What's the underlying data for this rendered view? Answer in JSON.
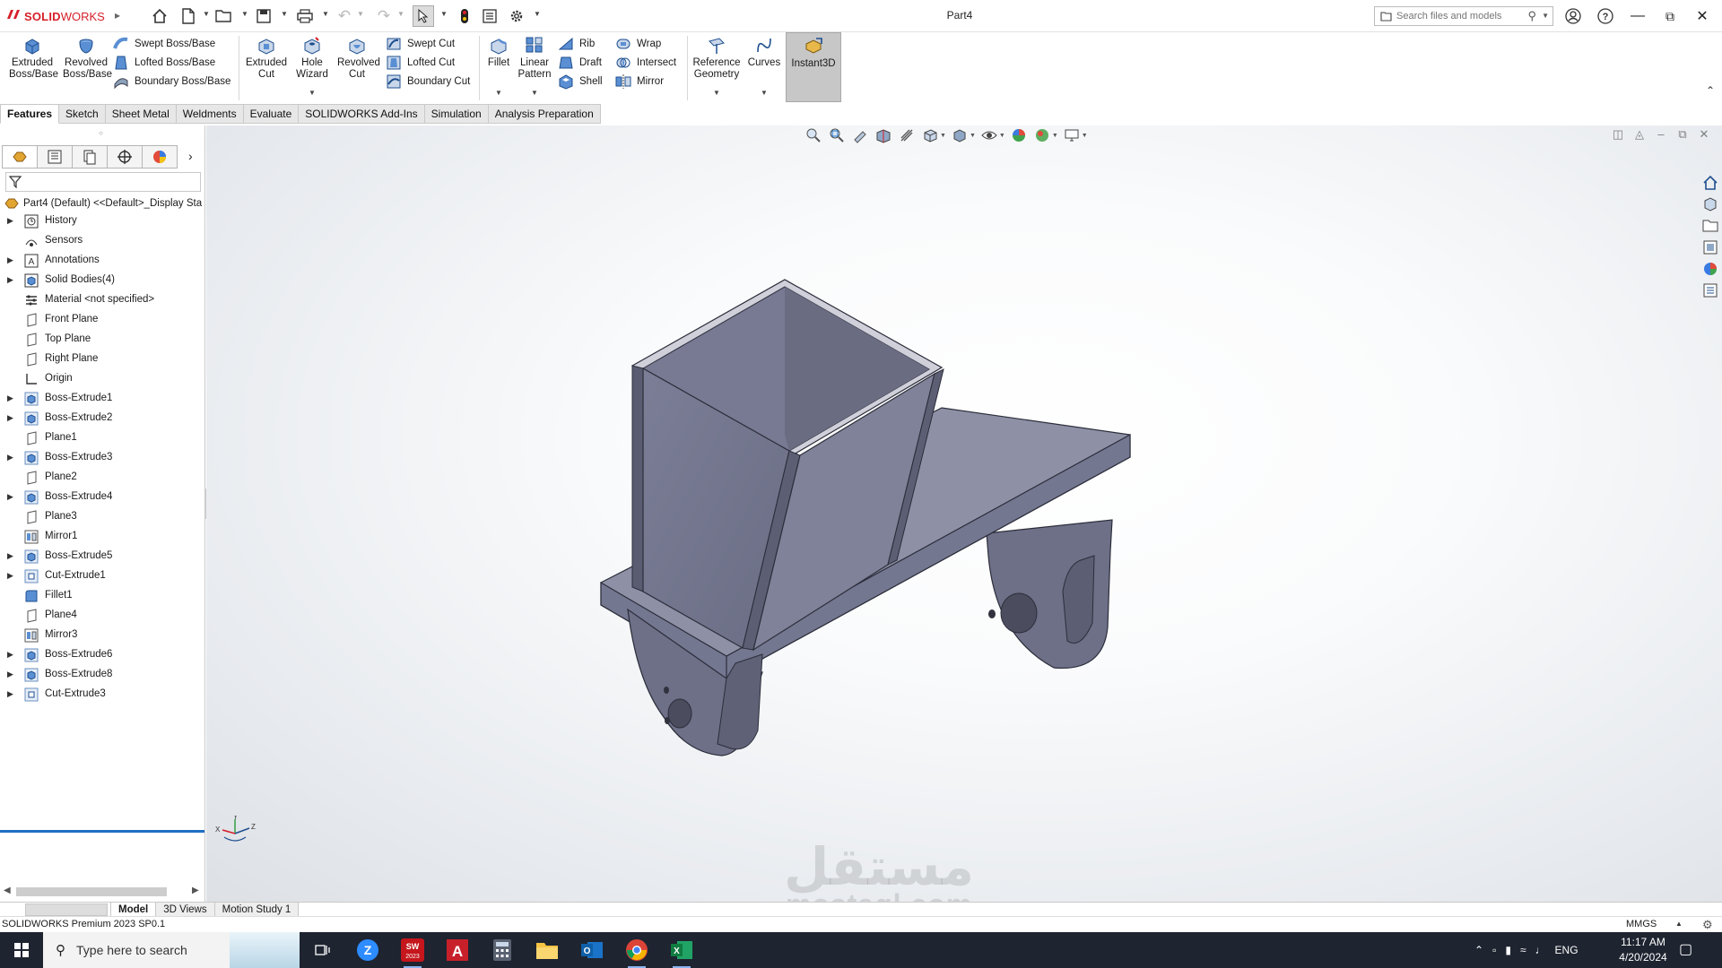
{
  "app": {
    "logo_prefix": "3S",
    "logo_text": "SOLID",
    "logo_text_light": "WORKS",
    "document_title": "Part4",
    "search_placeholder": "Search files and models"
  },
  "ribbon": {
    "extruded_boss": "Extruded Boss/Base",
    "revolved_boss": "Revolved Boss/Base",
    "swept_boss": "Swept Boss/Base",
    "lofted_boss": "Lofted Boss/Base",
    "boundary_boss": "Boundary Boss/Base",
    "extruded_cut": "Extruded Cut",
    "hole_wizard": "Hole Wizard",
    "revolved_cut": "Revolved Cut",
    "swept_cut": "Swept Cut",
    "lofted_cut": "Lofted Cut",
    "boundary_cut": "Boundary Cut",
    "fillet": "Fillet",
    "linear_pattern": "Linear Pattern",
    "rib": "Rib",
    "draft": "Draft",
    "shell": "Shell",
    "wrap": "Wrap",
    "intersect": "Intersect",
    "mirror": "Mirror",
    "reference_geometry": "Reference Geometry",
    "curves": "Curves",
    "instant3d": "Instant3D"
  },
  "cm_tabs": [
    "Features",
    "Sketch",
    "Sheet Metal",
    "Weldments",
    "Evaluate",
    "SOLIDWORKS Add-Ins",
    "Simulation",
    "Analysis Preparation"
  ],
  "feature_tree": {
    "root": "Part4  (Default) <<Default>_Display Sta",
    "items": [
      {
        "label": "History",
        "icon": "history-icon",
        "expandable": true
      },
      {
        "label": "Sensors",
        "icon": "sensors-icon",
        "expandable": false
      },
      {
        "label": "Annotations",
        "icon": "annotations-icon",
        "expandable": true
      },
      {
        "label": "Solid Bodies(4)",
        "icon": "solid-bodies-icon",
        "expandable": true
      },
      {
        "label": "Material <not specified>",
        "icon": "material-icon",
        "expandable": false
      },
      {
        "label": "Front Plane",
        "icon": "plane-icon",
        "expandable": false
      },
      {
        "label": "Top Plane",
        "icon": "plane-icon",
        "expandable": false
      },
      {
        "label": "Right Plane",
        "icon": "plane-icon",
        "expandable": false
      },
      {
        "label": "Origin",
        "icon": "origin-icon",
        "expandable": false
      },
      {
        "label": "Boss-Extrude1",
        "icon": "boss-extrude-icon",
        "expandable": true
      },
      {
        "label": "Boss-Extrude2",
        "icon": "boss-extrude-icon",
        "expandable": true
      },
      {
        "label": "Plane1",
        "icon": "plane-icon",
        "expandable": false
      },
      {
        "label": "Boss-Extrude3",
        "icon": "boss-extrude-icon",
        "expandable": true
      },
      {
        "label": "Plane2",
        "icon": "plane-icon",
        "expandable": false
      },
      {
        "label": "Boss-Extrude4",
        "icon": "boss-extrude-icon",
        "expandable": true
      },
      {
        "label": "Plane3",
        "icon": "plane-icon",
        "expandable": false
      },
      {
        "label": "Mirror1",
        "icon": "mirror-icon",
        "expandable": false
      },
      {
        "label": "Boss-Extrude5",
        "icon": "boss-extrude-icon",
        "expandable": true
      },
      {
        "label": "Cut-Extrude1",
        "icon": "cut-extrude-icon",
        "expandable": true
      },
      {
        "label": "Fillet1",
        "icon": "fillet-icon",
        "expandable": false
      },
      {
        "label": "Plane4",
        "icon": "plane-icon",
        "expandable": false
      },
      {
        "label": "Mirror3",
        "icon": "mirror-icon",
        "expandable": false
      },
      {
        "label": "Boss-Extrude6",
        "icon": "boss-extrude-icon",
        "expandable": true
      },
      {
        "label": "Boss-Extrude8",
        "icon": "boss-extrude-icon",
        "expandable": true
      },
      {
        "label": "Cut-Extrude3",
        "icon": "cut-extrude-icon",
        "expandable": true
      }
    ]
  },
  "triad": {
    "x": "X",
    "y": "Y",
    "z": "Z"
  },
  "watermark": {
    "arabic": "مستقل",
    "latin": "mostaql.com"
  },
  "bottom_tabs": [
    "Model",
    "3D Views",
    "Motion Study 1"
  ],
  "status": {
    "text": "SOLIDWORKS Premium 2023 SP0.1",
    "units": "MMGS"
  },
  "taskbar": {
    "search_placeholder": "Type here to search",
    "language": "ENG",
    "time": "11:17 AM",
    "date": "4/20/2024",
    "sw_badge": "SW\n2023"
  },
  "colors": {
    "accent_red": "#d6202a",
    "model_body": "#8a8da3",
    "selection_blue": "#1f6fc2"
  }
}
